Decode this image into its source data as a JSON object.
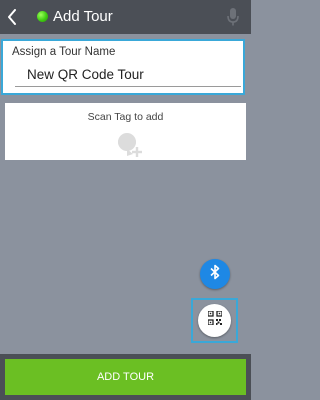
{
  "header": {
    "title": "Add Tour",
    "back_icon": "back-arrow-icon",
    "status_icon": "status-dot-icon",
    "mic_icon": "microphone-icon",
    "status_color": "#3fcb12"
  },
  "name_card": {
    "label": "Assign a Tour Name",
    "value": "New QR Code Tour"
  },
  "scan_card": {
    "label": "Scan Tag to add",
    "icon": "add-tag-icon"
  },
  "fabs": {
    "bluetooth_icon": "bluetooth-icon",
    "qr_icon": "qr-code-icon"
  },
  "footer": {
    "add_label": "ADD TOUR"
  },
  "colors": {
    "topbar": "#4b4f56",
    "background": "#8b929e",
    "accent_highlight": "#3aa8d8",
    "primary_button": "#6bbf23",
    "bluetooth_fab": "#1e88e5"
  }
}
